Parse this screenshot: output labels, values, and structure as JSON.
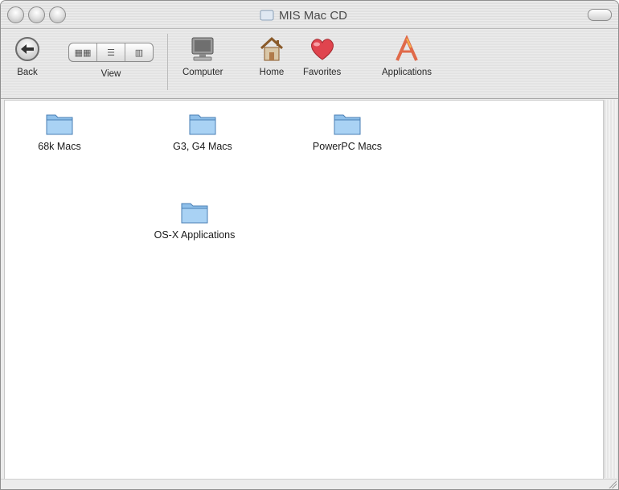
{
  "window": {
    "title": "MIS Mac CD"
  },
  "toolbar": {
    "back_label": "Back",
    "view_label": "View",
    "view_modes": [
      "▦▦",
      "☰",
      "▥"
    ],
    "computer_label": "Computer",
    "home_label": "Home",
    "favorites_label": "Favorites",
    "applications_label": "Applications"
  },
  "folders": [
    {
      "label": "68k Macs"
    },
    {
      "label": "G3, G4 Macs"
    },
    {
      "label": "PowerPC Macs"
    },
    {
      "label": "OS-X Applications"
    }
  ],
  "colors": {
    "folder_blue": "#8fc0ea",
    "favorites_red": "#e0444e",
    "home_brown": "#b07a4a"
  }
}
